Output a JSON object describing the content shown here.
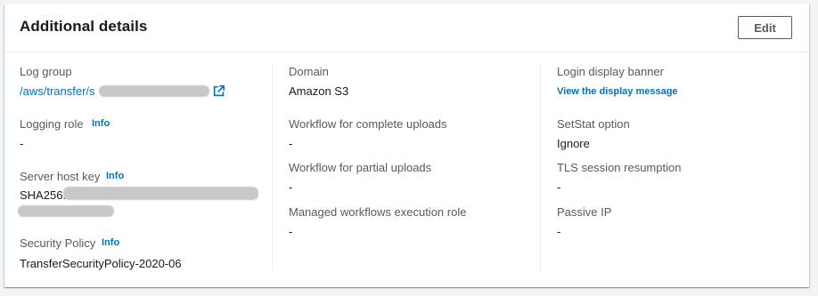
{
  "header": {
    "title": "Additional details",
    "edit_label": "Edit"
  },
  "col1": {
    "log_group_label": "Log group",
    "log_group_value": "/aws/transfer/s",
    "logging_role_label": "Logging role",
    "logging_role_info": "Info",
    "logging_role_value": "-",
    "server_host_key_label": "Server host key",
    "server_host_key_info": "Info",
    "server_host_key_value": "SHA256:",
    "security_policy_label": "Security Policy",
    "security_policy_info": "Info",
    "security_policy_value": "TransferSecurityPolicy-2020-06"
  },
  "col2": {
    "domain_label": "Domain",
    "domain_value": "Amazon S3",
    "workflow_complete_label": "Workflow for complete uploads",
    "workflow_complete_value": "-",
    "workflow_partial_label": "Workflow for partial uploads",
    "workflow_partial_value": "-",
    "managed_role_label": "Managed workflows execution role",
    "managed_role_value": "-"
  },
  "col3": {
    "login_banner_label": "Login display banner",
    "login_banner_link": "View the display message",
    "setstat_label": "SetStat option",
    "setstat_value": "Ignore",
    "tls_label": "TLS session resumption",
    "tls_value": "-",
    "passive_ip_label": "Passive IP",
    "passive_ip_value": "-"
  },
  "colors": {
    "link": "#0073bb",
    "label": "#545b64",
    "text": "#16191f",
    "redaction": "#c8c8c8"
  }
}
